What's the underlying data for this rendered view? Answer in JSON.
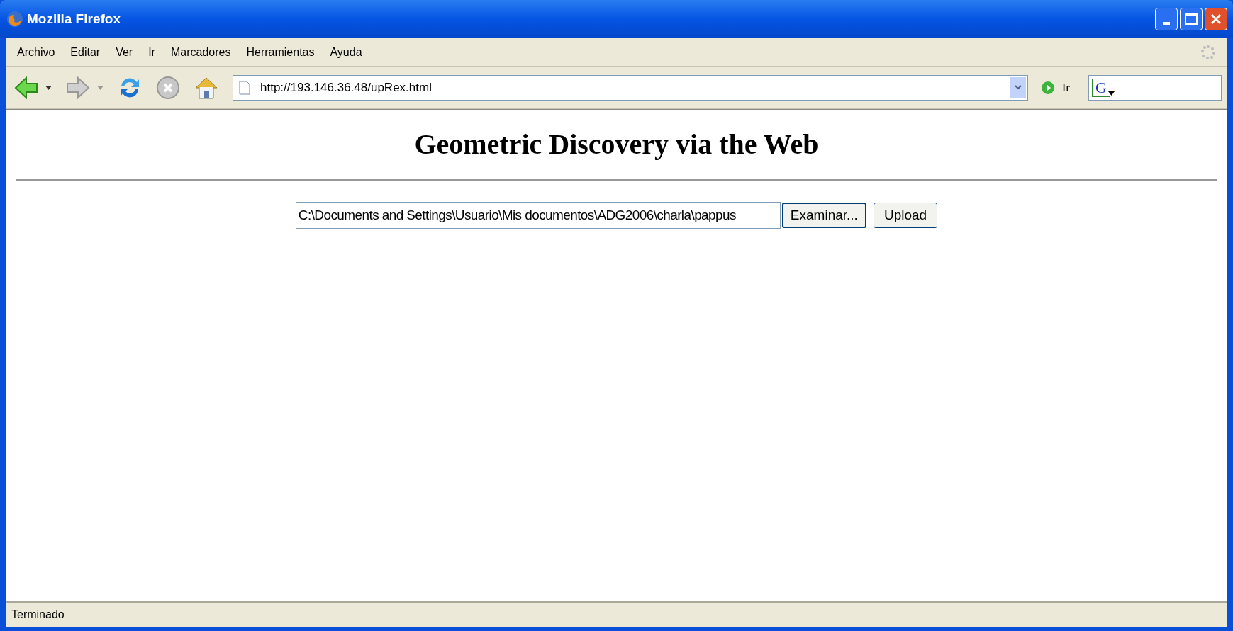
{
  "window": {
    "title": "Mozilla Firefox"
  },
  "menu": [
    "Archivo",
    "Editar",
    "Ver",
    "Ir",
    "Marcadores",
    "Herramientas",
    "Ayuda"
  ],
  "toolbar": {
    "back_disabled": false,
    "forward_disabled": true,
    "address": "http://193.146.36.48/upRex.html",
    "go_label": "Ir",
    "search_engine_letter": "G"
  },
  "page": {
    "heading": "Geometric Discovery via the Web",
    "file_field": {
      "value": "C:\\Documents and Settings\\Usuario\\Mis documentos\\ADG2006\\charla\\pappus"
    },
    "browse_button": "Examinar...",
    "upload_button": "Upload"
  },
  "status_bar": "Terminado"
}
